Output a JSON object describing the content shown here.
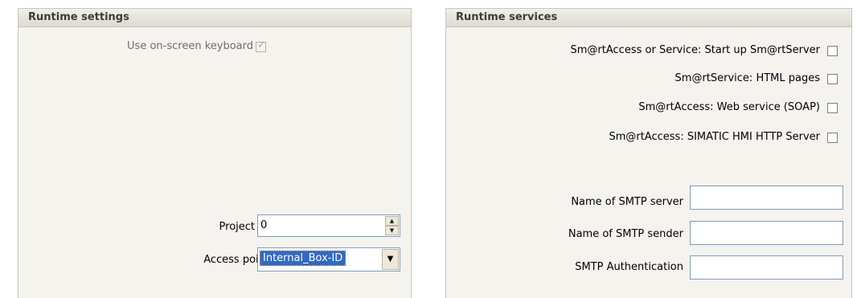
{
  "left_panel": {
    "title": "Runtime settings",
    "keyboard_label": "Use on-screen keyboard",
    "keyboard_checked": true,
    "project_id_label": "Project ID",
    "project_id_value": "0",
    "access_point_label": "Access point",
    "access_point_value": "Internal_Box-ID"
  },
  "right_panel": {
    "title": "Runtime services",
    "services": [
      {
        "label": "Sm@rtAccess or Service: Start up Sm@rtServer",
        "checked": false
      },
      {
        "label": "Sm@rtService: HTML pages",
        "checked": false
      },
      {
        "label": "Sm@rtAccess: Web service (SOAP)",
        "checked": false
      },
      {
        "label": "Sm@rtAccess: SIMATIC HMI HTTP Server",
        "checked": false
      }
    ],
    "smtp_server_label": "Name of SMTP server",
    "smtp_server_value": "",
    "smtp_sender_label": "Name of SMTP sender",
    "smtp_sender_value": "",
    "smtp_auth_label": "SMTP Authentication",
    "smtp_auth_value": ""
  },
  "icons": {
    "spin_up": "▲",
    "spin_down": "▼",
    "dropdown": "▼",
    "check": "✓"
  }
}
